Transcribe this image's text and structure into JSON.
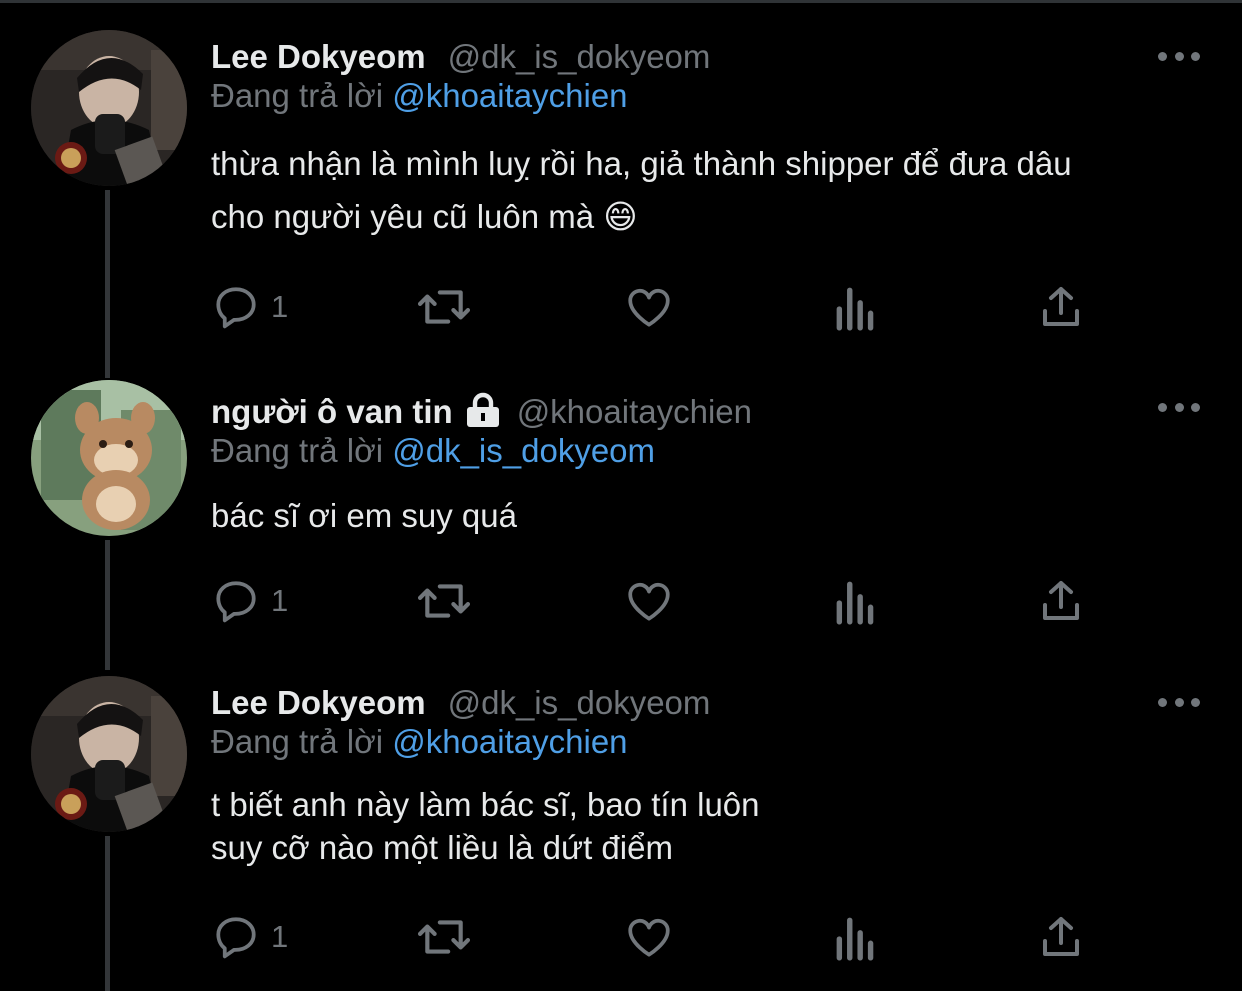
{
  "tweets": [
    {
      "name": "Lee Dokyeom",
      "handle": "@dk_is_dokyeom",
      "replying_prefix": "Đang trả lời",
      "replying_to": "@khoaitaychien",
      "text": "thừa nhận là mình luỵ rồi ha, giả thành shipper để đưa dâu\ncho người yêu cũ luôn mà 😄",
      "reply_count": "1",
      "locked": false
    },
    {
      "name": "người ô van tin",
      "handle": "@khoaitaychien",
      "replying_prefix": "Đang trả lời",
      "replying_to": "@dk_is_dokyeom",
      "text": "bác sĩ ơi em suy quá",
      "reply_count": "1",
      "locked": true
    },
    {
      "name": "Lee Dokyeom",
      "handle": "@dk_is_dokyeom",
      "replying_prefix": "Đang trả lời",
      "replying_to": "@khoaitaychien",
      "text": "t biết anh này làm bác sĩ, bao tín luôn\nsuy cỡ nào một liều là dứt điểm",
      "reply_count": "1",
      "locked": false
    }
  ],
  "icons": {
    "reply": "reply-icon",
    "retweet": "retweet-icon",
    "like": "heart-icon",
    "views": "analytics-icon",
    "share": "share-icon",
    "more": "more-icon",
    "lock": "lock-icon"
  },
  "colors": {
    "background": "#000000",
    "text": "#e7e9ea",
    "muted": "#71767b",
    "mention": "#4f9fe6",
    "thread_line": "#333639"
  }
}
